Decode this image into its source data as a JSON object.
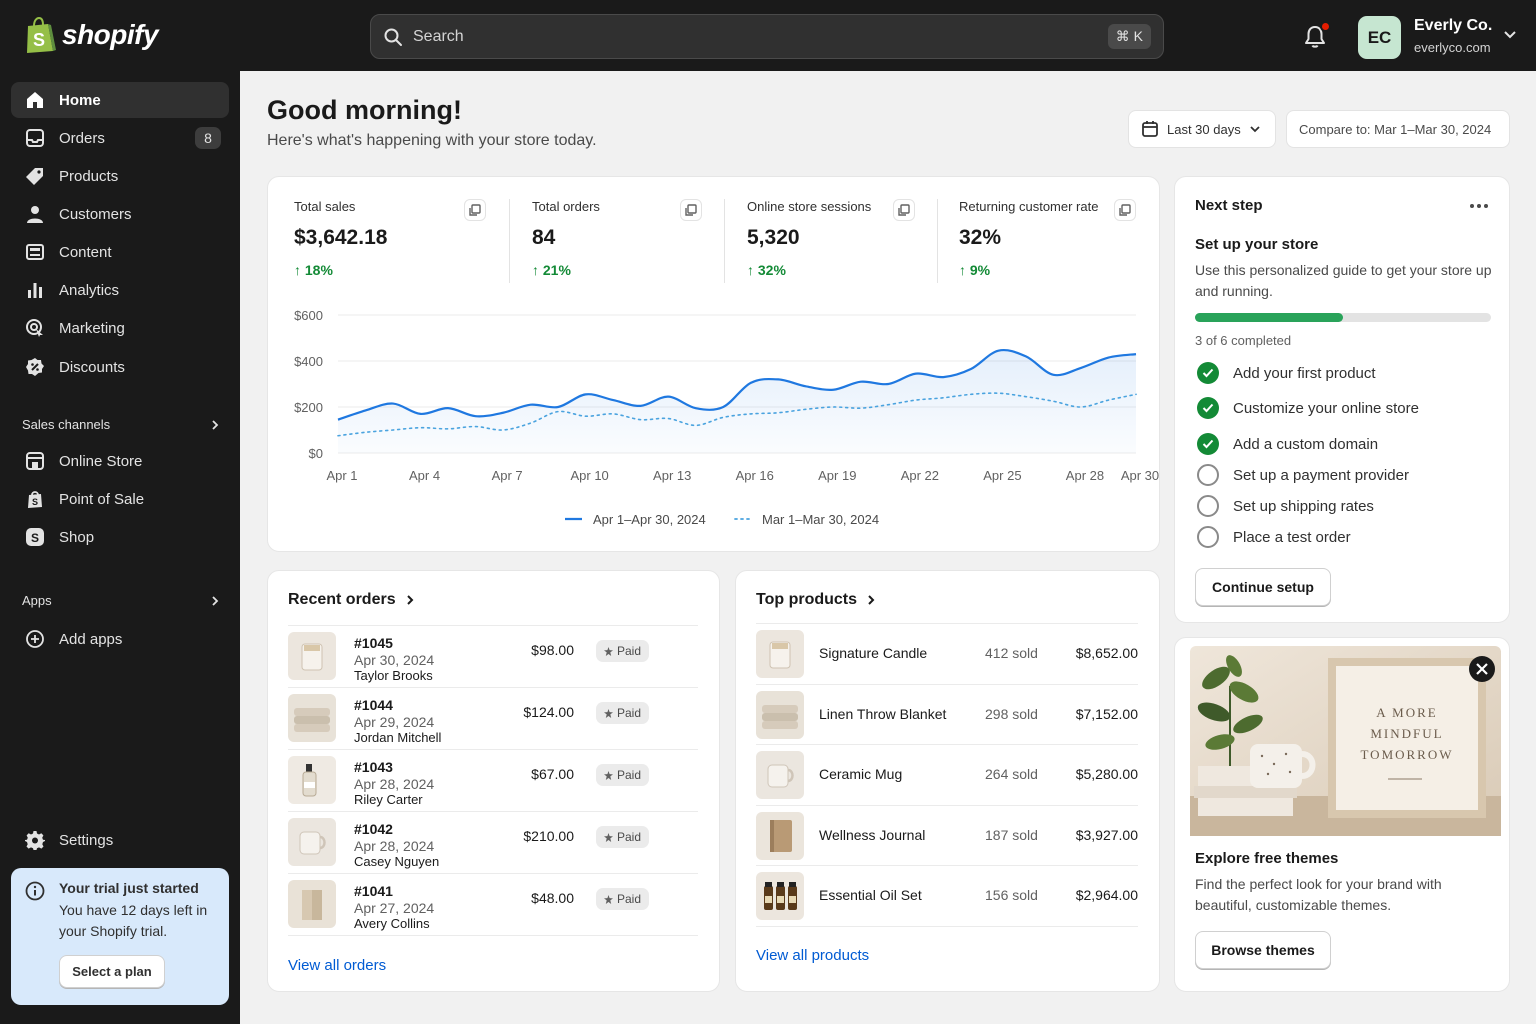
{
  "brand": {
    "name": "shopify"
  },
  "search": {
    "placeholder": "Search",
    "shortcut": "⌘ K"
  },
  "account": {
    "initials": "EC",
    "store_name": "Everly Co.",
    "store_url": "everlyco.com"
  },
  "sidebar": {
    "items": [
      {
        "label": "Home",
        "icon": "home-icon"
      },
      {
        "label": "Orders",
        "icon": "orders-icon",
        "badge": "8"
      },
      {
        "label": "Products",
        "icon": "tag-icon"
      },
      {
        "label": "Customers",
        "icon": "person-icon"
      },
      {
        "label": "Content",
        "icon": "content-icon"
      },
      {
        "label": "Analytics",
        "icon": "bar-chart-icon"
      },
      {
        "label": "Marketing",
        "icon": "target-icon"
      },
      {
        "label": "Discounts",
        "icon": "discount-icon"
      }
    ],
    "sales_channels_label": "Sales channels",
    "channels": [
      {
        "label": "Online Store",
        "icon": "store-icon"
      },
      {
        "label": "Point of Sale",
        "icon": "pos-icon"
      },
      {
        "label": "Shop",
        "icon": "shop-icon"
      }
    ],
    "apps_label": "Apps",
    "add_apps": "Add apps",
    "settings": "Settings",
    "trial": {
      "title": "Your trial just started",
      "text": "You have 12 days left in your Shopify trial.",
      "button": "Select a plan"
    }
  },
  "header": {
    "greeting": "Good morning!",
    "subtitle": "Here's what's happening with your store today.",
    "date_range": "Last 30 days",
    "compare": "Compare to: Mar 1–Mar 30, 2024"
  },
  "metrics": [
    {
      "label": "Total sales",
      "value": "$3,642.18",
      "delta": "18%"
    },
    {
      "label": "Total orders",
      "value": "84",
      "delta": "21%"
    },
    {
      "label": "Online store sessions",
      "value": "5,320",
      "delta": "32%"
    },
    {
      "label": "Returning customer rate",
      "value": "32%",
      "delta": "9%"
    }
  ],
  "chart_data": {
    "type": "line",
    "x": [
      "Apr 1",
      "Apr 2",
      "Apr 3",
      "Apr 4",
      "Apr 5",
      "Apr 6",
      "Apr 7",
      "Apr 8",
      "Apr 9",
      "Apr 10",
      "Apr 11",
      "Apr 12",
      "Apr 13",
      "Apr 14",
      "Apr 15",
      "Apr 16",
      "Apr 17",
      "Apr 18",
      "Apr 19",
      "Apr 20",
      "Apr 21",
      "Apr 22",
      "Apr 23",
      "Apr 24",
      "Apr 25",
      "Apr 26",
      "Apr 27",
      "Apr 28",
      "Apr 29",
      "Apr 30"
    ],
    "xticks": [
      "Apr 1",
      "Apr 4",
      "Apr 7",
      "Apr 10",
      "Apr 13",
      "Apr 16",
      "Apr 19",
      "Apr 22",
      "Apr 25",
      "Apr 28",
      "Apr 30"
    ],
    "yticks": [
      "$0",
      "$200",
      "$400",
      "$600"
    ],
    "ylim": [
      0,
      600
    ],
    "series": [
      {
        "name": "Apr 1–Apr 30, 2024",
        "style": "solid",
        "color": "#1f78e0",
        "values": [
          145,
          185,
          215,
          170,
          195,
          160,
          175,
          210,
          200,
          255,
          230,
          205,
          245,
          195,
          200,
          305,
          320,
          290,
          275,
          310,
          300,
          345,
          330,
          365,
          445,
          420,
          340,
          370,
          415,
          430
        ]
      },
      {
        "name": "Mar 1–Mar 30, 2024",
        "style": "dotted",
        "color": "#4aa3df",
        "values": [
          75,
          90,
          100,
          110,
          105,
          115,
          100,
          130,
          180,
          160,
          170,
          145,
          150,
          120,
          155,
          170,
          175,
          190,
          200,
          195,
          210,
          230,
          240,
          255,
          260,
          245,
          225,
          200,
          230,
          255
        ]
      }
    ]
  },
  "recent_orders": {
    "title": "Recent orders",
    "view_all": "View all orders",
    "rows": [
      {
        "id": "#1045",
        "date": "Apr 30, 2024",
        "customer": "Taylor Brooks",
        "amount": "$98.00",
        "status": "Paid",
        "thumb": "candle"
      },
      {
        "id": "#1044",
        "date": "Apr 29, 2024",
        "customer": "Jordan Mitchell",
        "amount": "$124.00",
        "status": "Paid",
        "thumb": "blanket"
      },
      {
        "id": "#1043",
        "date": "Apr 28, 2024",
        "customer": "Riley Carter",
        "amount": "$67.00",
        "status": "Paid",
        "thumb": "bottle"
      },
      {
        "id": "#1042",
        "date": "Apr 28, 2024",
        "customer": "Casey Nguyen",
        "amount": "$210.00",
        "status": "Paid",
        "thumb": "mug"
      },
      {
        "id": "#1041",
        "date": "Apr 27, 2024",
        "customer": "Avery Collins",
        "amount": "$48.00",
        "status": "Paid",
        "thumb": "box"
      }
    ]
  },
  "top_products": {
    "title": "Top products",
    "view_all": "View all products",
    "rows": [
      {
        "name": "Signature Candle",
        "sold": "412 sold",
        "revenue": "$8,652.00",
        "thumb": "candle"
      },
      {
        "name": "Linen Throw Blanket",
        "sold": "298 sold",
        "revenue": "$7,152.00",
        "thumb": "blanket"
      },
      {
        "name": "Ceramic Mug",
        "sold": "264 sold",
        "revenue": "$5,280.00",
        "thumb": "mug"
      },
      {
        "name": "Wellness Journal",
        "sold": "187 sold",
        "revenue": "$3,927.00",
        "thumb": "journal"
      },
      {
        "name": "Essential Oil Set",
        "sold": "156 sold",
        "revenue": "$2,964.00",
        "thumb": "oils"
      }
    ]
  },
  "next_step": {
    "title": "Next step",
    "heading": "Set up your store",
    "text": "Use this personalized guide to get your store up and running.",
    "progress": 0.5,
    "progress_text": "3 of 6 completed",
    "steps": [
      {
        "label": "Add your first product",
        "done": true
      },
      {
        "label": "Customize your online store",
        "done": true
      },
      {
        "label": "Add a custom domain",
        "done": true
      },
      {
        "label": "Set up a payment provider",
        "done": false
      },
      {
        "label": "Set up shipping rates",
        "done": false
      },
      {
        "label": "Place a test order",
        "done": false
      }
    ],
    "button": "Continue setup"
  },
  "themes": {
    "poster": [
      "A MORE",
      "MINDFUL",
      "TOMORROW"
    ],
    "title": "Explore free themes",
    "text": "Find the perfect look for your brand with beautiful, customizable themes.",
    "button": "Browse themes"
  }
}
